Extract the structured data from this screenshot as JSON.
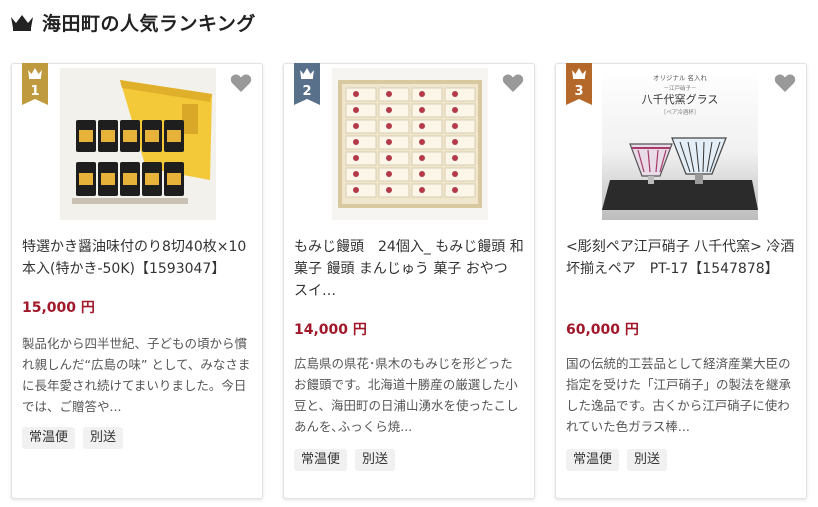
{
  "header": {
    "title": "海田町の人気ランキング",
    "icon": "crown-icon"
  },
  "colors": {
    "rank1": "#bf9a3e",
    "rank2": "#58708a",
    "rank3": "#b4692a",
    "price": "#a0182a",
    "heart": "#999999"
  },
  "items": [
    {
      "rank": "1",
      "name": "特選かき醤油味付のり8切40枚×10本入(特かき-50K)【1593047】",
      "price": "15,000 円",
      "description": "製品化から四半世紀、子どもの頃から慣れ親しんだ“広島の味” として、みなさまに長年愛され続けてまいりました。今日では、ご贈答や...",
      "tags": [
        "常温便",
        "別送"
      ]
    },
    {
      "rank": "2",
      "name": "もみじ饅頭　24個入_ もみじ饅頭 和菓子 饅頭 まんじゅう 菓子 おやつ スイ…",
      "price": "14,000 円",
      "description": "広島県の県花･県木のもみじを形どったお饅頭です。北海道十勝産の厳選した小豆と、海田町の日浦山湧水を使ったこしあんを､ふっくら焼...",
      "tags": [
        "常温便",
        "別送"
      ]
    },
    {
      "rank": "3",
      "name": "<彫刻ペア江戸硝子 八千代窯> 冷酒坏揃えペア　PT-17【1547878】",
      "price": "60,000 円",
      "description": "国の伝統的工芸品として経済産業大臣の指定を受けた「江戸硝子」の製法を継承した逸品です。古くから江戸硝子に使われていた色ガラス棒...",
      "tags": [
        "常温便",
        "別送"
      ]
    }
  ],
  "product_image_text": {
    "line1": "オリジナル 名入れ",
    "line2": "－江戸硝子－",
    "line3": "八千代窯グラス",
    "line4": "［ペア冷酒杯］"
  }
}
